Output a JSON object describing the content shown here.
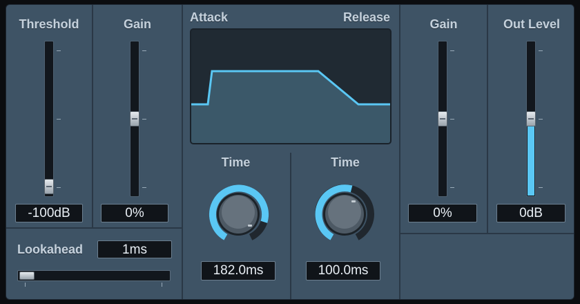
{
  "threshold": {
    "label": "Threshold",
    "value": "-100dB",
    "level": 0.02
  },
  "gain_in": {
    "label": "Gain",
    "value": "0%",
    "level": 0.5
  },
  "envelope": {
    "attack_label": "Attack",
    "release_label": "Release"
  },
  "attack_time": {
    "label": "Time",
    "value": "182.0ms",
    "level": 0.8
  },
  "release_time": {
    "label": "Time",
    "value": "100.0ms",
    "level": 0.3
  },
  "gain_out": {
    "label": "Gain",
    "value": "0%",
    "level": 0.5
  },
  "out_level": {
    "label": "Out Level",
    "value": "0dB",
    "level": 0.5
  },
  "lookahead": {
    "label": "Lookahead",
    "value": "1ms",
    "level": 0.04
  },
  "colors": {
    "panel": "#3e5365",
    "accent": "#5ac7f4",
    "display_bg": "#101419"
  }
}
